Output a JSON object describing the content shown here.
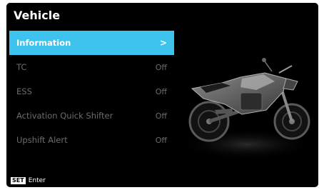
{
  "screen": {
    "title": "Vehicle"
  },
  "menu": [
    {
      "label": "Information",
      "value": ">",
      "selected": true
    },
    {
      "label": "TC",
      "value": "Off",
      "selected": false
    },
    {
      "label": "ESS",
      "value": "Off",
      "selected": false
    },
    {
      "label": "Activation Quick Shifter",
      "value": "Off",
      "selected": false
    },
    {
      "label": "Upshift Alert",
      "value": "Off",
      "selected": false
    }
  ],
  "footer": {
    "key": "SET",
    "action": "Enter"
  },
  "colors": {
    "accent": "#3ec3ef",
    "background": "#000000",
    "inactive_text": "#6c6c6c"
  },
  "icons": {
    "bike": "motorcycle-image",
    "chevron": "chevron-right-icon"
  }
}
